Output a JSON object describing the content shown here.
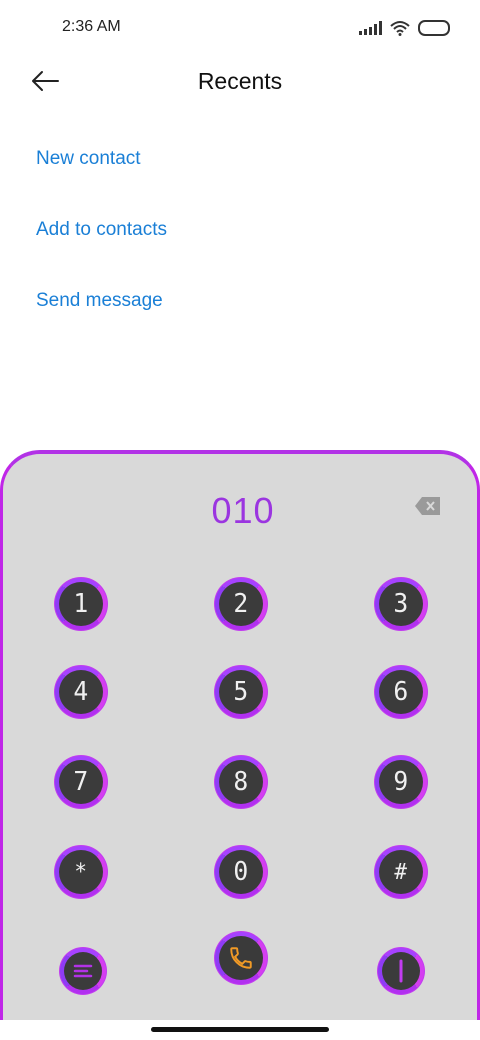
{
  "status": {
    "time": "2:36 AM"
  },
  "header": {
    "title": "Recents"
  },
  "actions": [
    {
      "label": "New contact"
    },
    {
      "label": "Add to contacts"
    },
    {
      "label": "Send message"
    }
  ],
  "dialer": {
    "number": "010",
    "keys": [
      {
        "label": "1"
      },
      {
        "label": "2"
      },
      {
        "label": "3"
      },
      {
        "label": "4"
      },
      {
        "label": "5"
      },
      {
        "label": "6"
      },
      {
        "label": "7"
      },
      {
        "label": "8"
      },
      {
        "label": "9"
      },
      {
        "label": "*"
      },
      {
        "label": "0"
      },
      {
        "label": "#"
      }
    ],
    "bottom": [
      {
        "icon": "menu-icon"
      },
      {
        "icon": "phone-icon"
      },
      {
        "icon": "sim-icon"
      }
    ]
  },
  "colors": {
    "link": "#1a7fd6",
    "accent": "#9b35e0",
    "key_bg": "#3b3b3b",
    "call_icon": "#f19a26",
    "panel_bg": "#d9d9d9"
  }
}
